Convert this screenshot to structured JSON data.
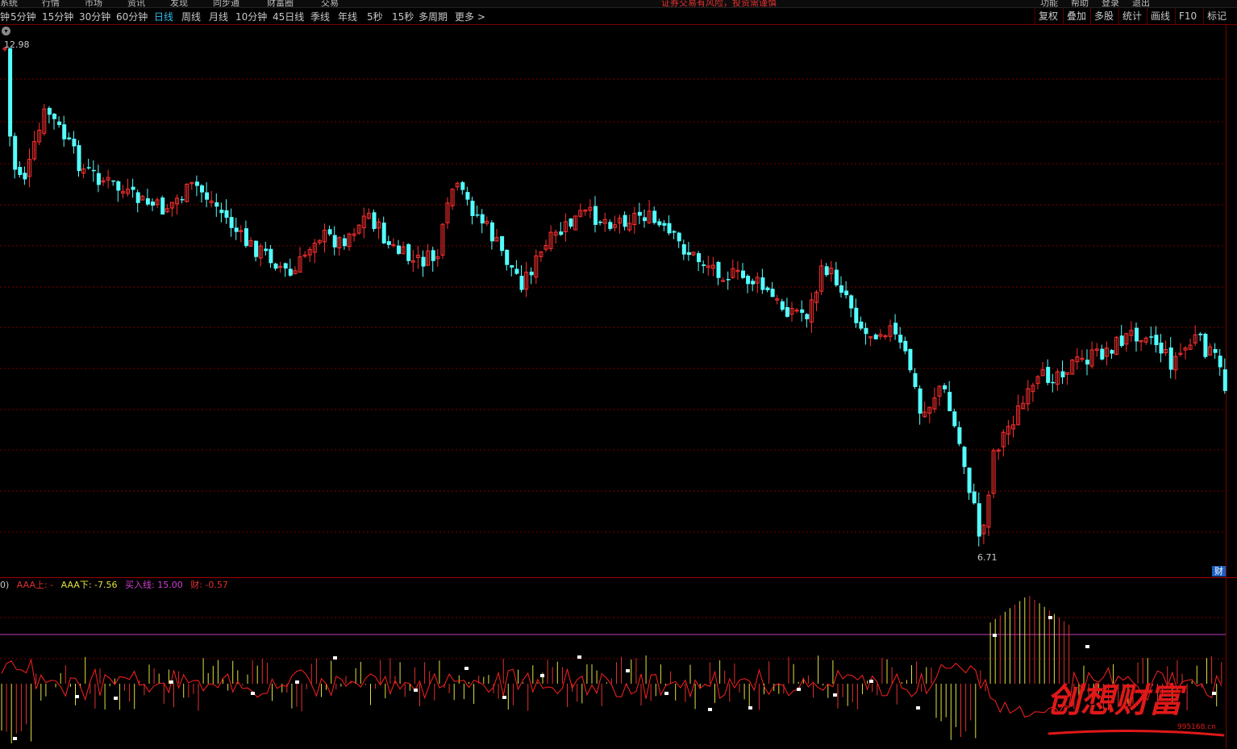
{
  "menubar": {
    "items": [
      "系统",
      "行情",
      "市场",
      "资讯",
      "发现",
      "同步通",
      "财富圈",
      "交易"
    ],
    "notice": "证券交易有风险，投资需谨慎",
    "right_items": [
      "功能",
      "帮助",
      "登录",
      "退出"
    ]
  },
  "toolbar": {
    "periods": [
      "钟",
      "5分钟",
      "15分钟",
      "30分钟",
      "60分钟",
      "日线",
      "周线",
      "月线",
      "10分钟",
      "45日线",
      "季线",
      "年线",
      "5秒",
      "15秒",
      "多周期",
      "更多 >"
    ],
    "active_period": "日线",
    "tools": [
      "复权",
      "叠加",
      "多股",
      "统计",
      "画线",
      "F10",
      "标记"
    ]
  },
  "price_chart": {
    "high_label": "12.98",
    "low_label": "6.71",
    "cai_label": "财"
  },
  "indicator": {
    "prefix": "0)",
    "aaa_up": "AAA上: -",
    "aaa_down": "AAA下: -7.56",
    "buy_line": "买入线: 15.00",
    "cai": "财: -0.57",
    "colors": {
      "aaa_up": "#e03030",
      "aaa_down": "#e0e040",
      "buy_line": "#d040d0",
      "cai": "#e03030"
    }
  },
  "colors": {
    "up": "#ff3030",
    "down": "#54ffff",
    "grid": "#7a0000",
    "buy_line": "#c040c0"
  },
  "watermark": {
    "text": "创想财富",
    "url": "995168.cn"
  }
}
